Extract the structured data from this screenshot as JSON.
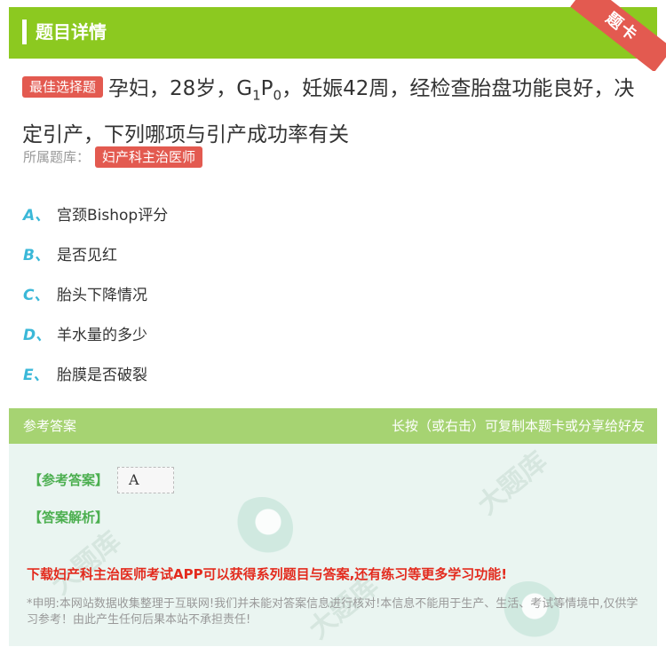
{
  "header": {
    "title": "题目详情",
    "ribbon": "题卡"
  },
  "question": {
    "badge": "最佳选择题",
    "text_before": "孕妇，28岁，G",
    "sub1": "1",
    "text_mid": "P",
    "sub2": "0",
    "text_after": "，妊娠42周，经检查胎盘功能良好，决定引产，下列哪项与引产成功率有关"
  },
  "category": {
    "label": "所属题库：",
    "value": "妇产科主治医师"
  },
  "options": [
    {
      "letter": "A、",
      "text": "宫颈Bishop评分"
    },
    {
      "letter": "B、",
      "text": "是否见红"
    },
    {
      "letter": "C、",
      "text": "胎头下降情况"
    },
    {
      "letter": "D、",
      "text": "羊水量的多少"
    },
    {
      "letter": "E、",
      "text": "胎膜是否破裂"
    }
  ],
  "answer_panel": {
    "header_left": "参考答案",
    "header_right": "长按（或右击）可复制本题卡或分享给好友",
    "answer_label": "【参考答案】",
    "answer_value": "A",
    "explanation_label": "【答案解析】",
    "promo": "下载妇产科主治医师考试APP可以获得系列题目与答案,还有练习等更多学习功能!",
    "disclaimer": "*申明:本网站数据收集整理于互联网!我们并未能对答案信息进行核对!本信息不能用于生产、生活、考试等情境中,仅供学习参考！由此产生任何后果本站不承担责任!"
  },
  "colors": {
    "brand_green": "#8cc920",
    "badge_red": "#e35a50",
    "option_letter": "#3bb8d8",
    "promo_red": "#e32b1e"
  }
}
